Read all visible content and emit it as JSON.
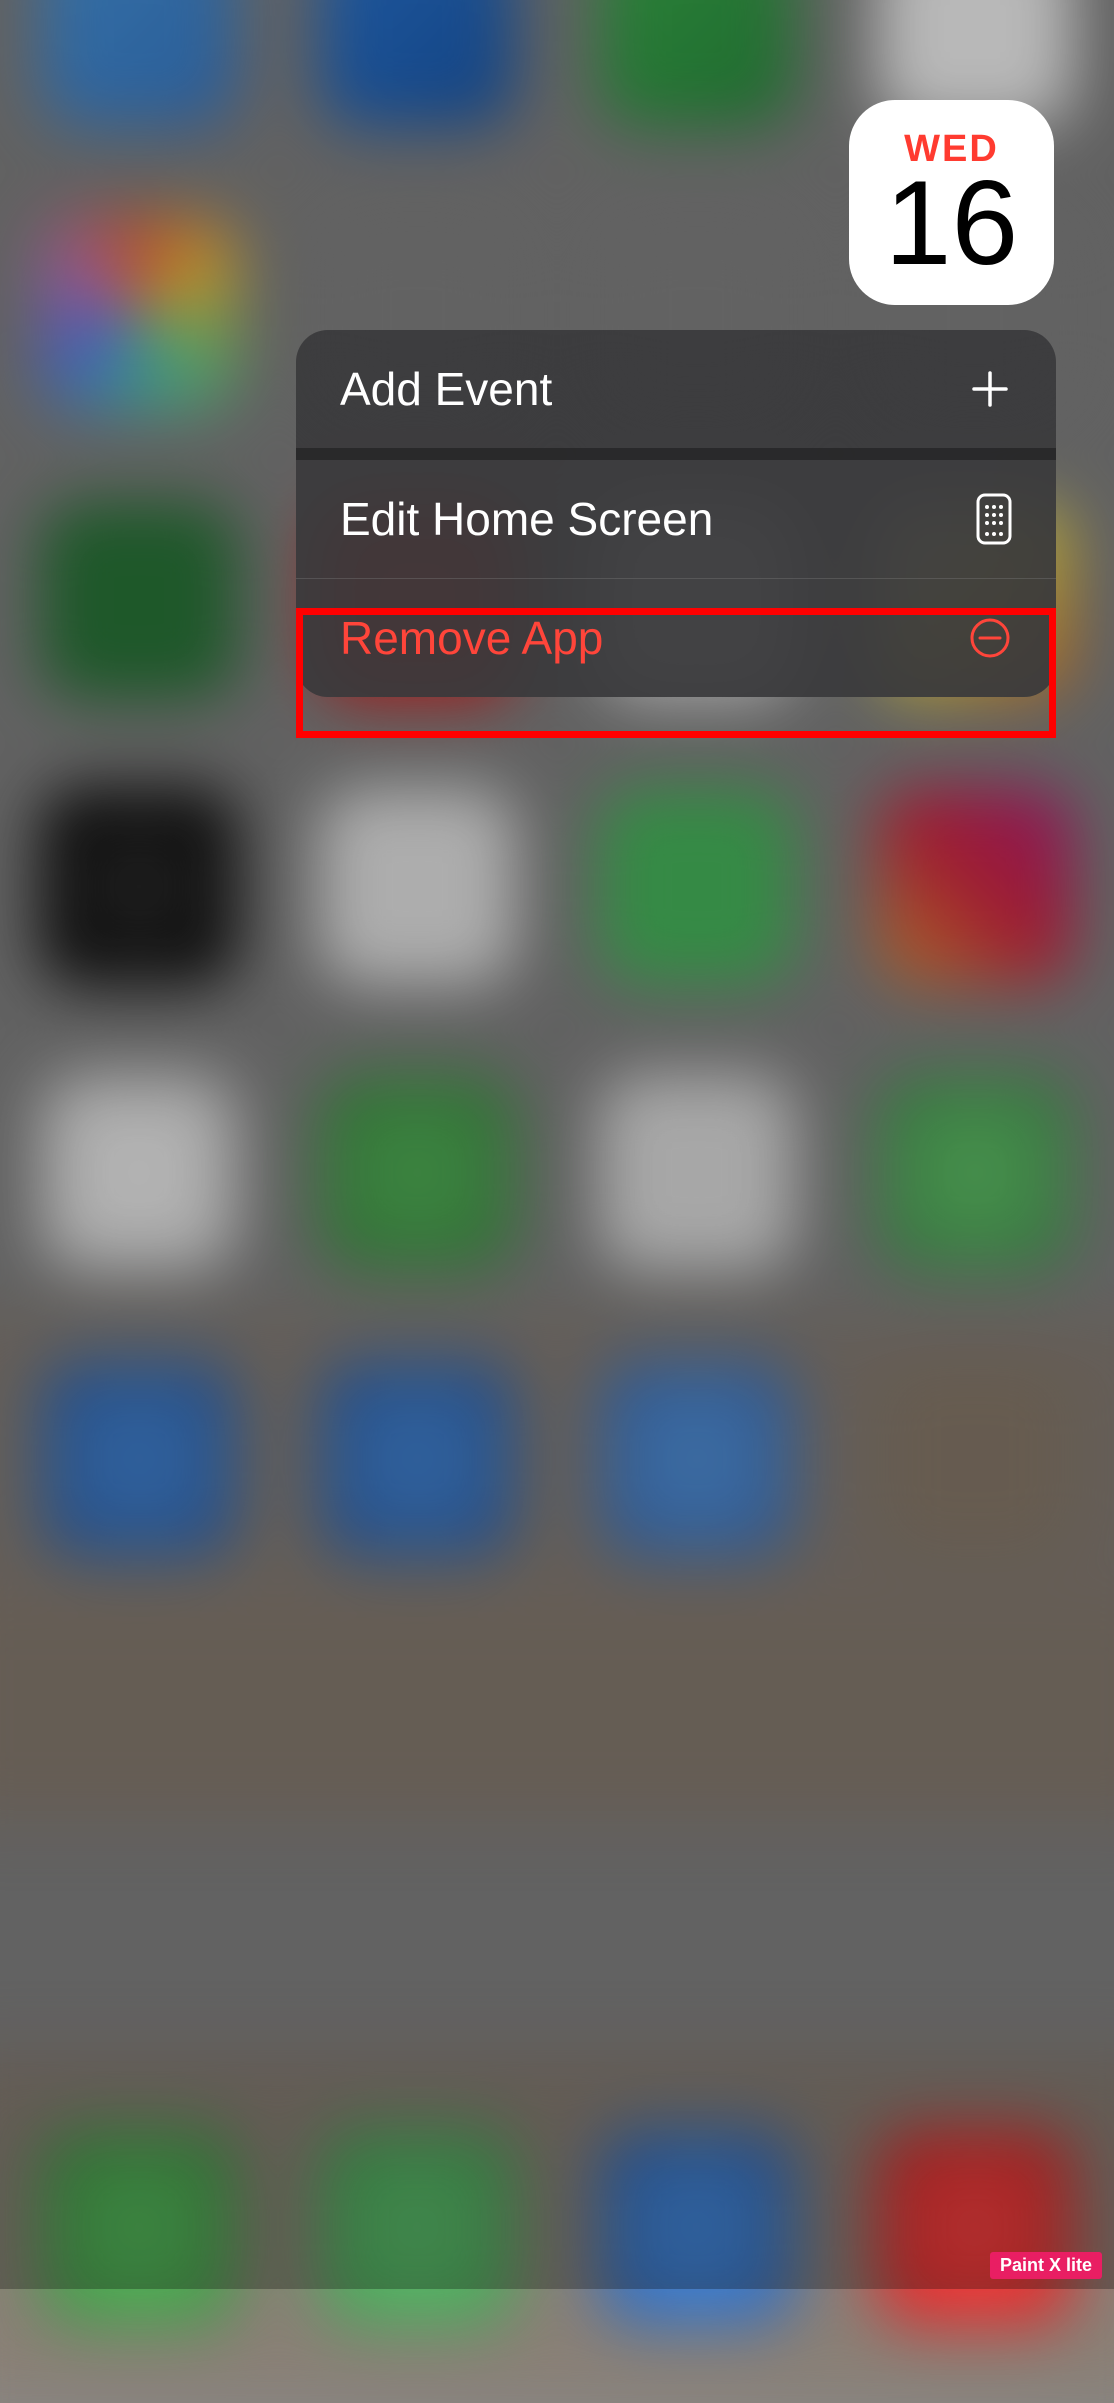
{
  "calendar": {
    "day_name": "WED",
    "day_number": "16"
  },
  "context_menu": {
    "items": [
      {
        "label": "Add Event",
        "icon": "plus",
        "destructive": false
      },
      {
        "label": "Edit Home Screen",
        "icon": "phone-grid",
        "destructive": false
      },
      {
        "label": "Remove App",
        "icon": "minus-circle",
        "destructive": true
      }
    ]
  },
  "watermark": "Paint X lite"
}
